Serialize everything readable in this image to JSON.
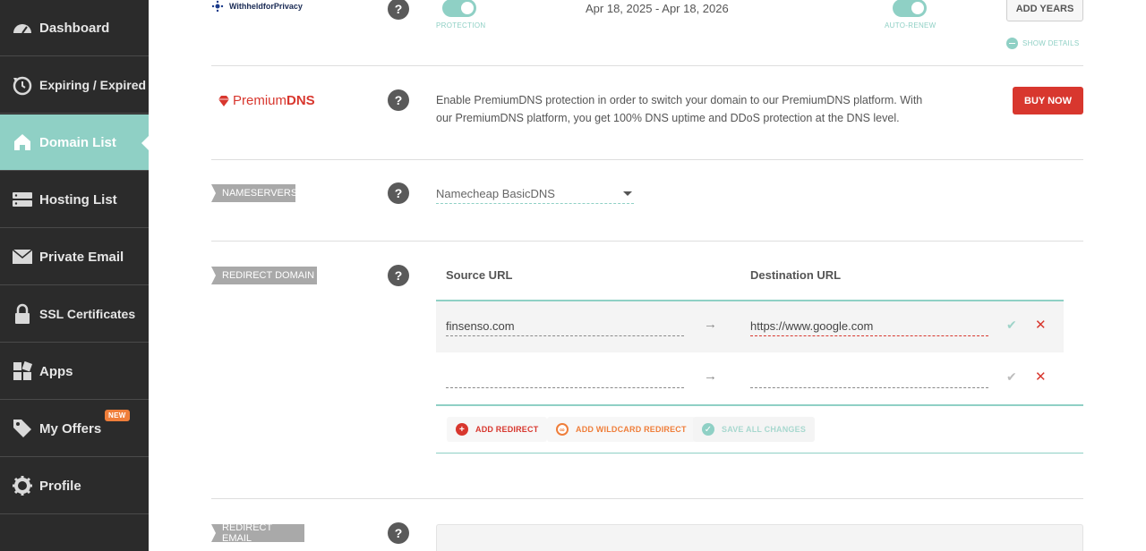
{
  "sidebar": {
    "items": [
      {
        "label": "Dashboard",
        "icon": "dashboard-gauge-icon"
      },
      {
        "label": "Expiring / Expired",
        "icon": "clock-history-icon"
      },
      {
        "label": "Domain List",
        "icon": "home-icon"
      },
      {
        "label": "Hosting List",
        "icon": "server-icon"
      },
      {
        "label": "Private Email",
        "icon": "envelope-icon"
      },
      {
        "label": "SSL Certificates",
        "icon": "lock-icon"
      },
      {
        "label": "Apps",
        "icon": "apps-grid-icon"
      },
      {
        "label": "My Offers",
        "icon": "tag-icon",
        "badge": "NEW"
      },
      {
        "label": "Profile",
        "icon": "gear-icon"
      }
    ],
    "active": "Domain List"
  },
  "privacy": {
    "logo_text": "WithheldforPrivacy",
    "protection_label": "PROTECTION",
    "date_range": "Apr 18, 2025 - Apr 18, 2026",
    "autorenew_label": "AUTO-RENEW",
    "add_years": "ADD YEARS",
    "show_details": "SHOW DETAILS"
  },
  "premiumdns": {
    "logo_prefix": "Premium",
    "logo_suffix": "DNS",
    "description": "Enable PremiumDNS protection in order to switch your domain to our PremiumDNS platform. With our PremiumDNS platform, you get 100% DNS uptime and DDoS protection at the DNS level.",
    "buy_now": "BUY NOW"
  },
  "nameservers": {
    "tag": "NAMESERVERS",
    "selected": "Namecheap BasicDNS"
  },
  "redirect_domain": {
    "tag": "REDIRECT DOMAIN",
    "source_header": "Source URL",
    "destination_header": "Destination URL",
    "rows": [
      {
        "source": "finsenso.com",
        "destination": "https://www.google.com"
      },
      {
        "source": "",
        "destination": ""
      }
    ],
    "arrow": "→",
    "add_redirect": "ADD REDIRECT",
    "add_wildcard": "ADD WILDCARD REDIRECT",
    "save_all": "SAVE ALL CHANGES"
  },
  "redirect_email": {
    "tag": "REDIRECT EMAIL"
  },
  "colors": {
    "sidebar_bg": "#2b2b2b",
    "accent_teal": "#8fd0c5",
    "danger_red": "#d8372e",
    "orange": "#ef7e3a"
  }
}
